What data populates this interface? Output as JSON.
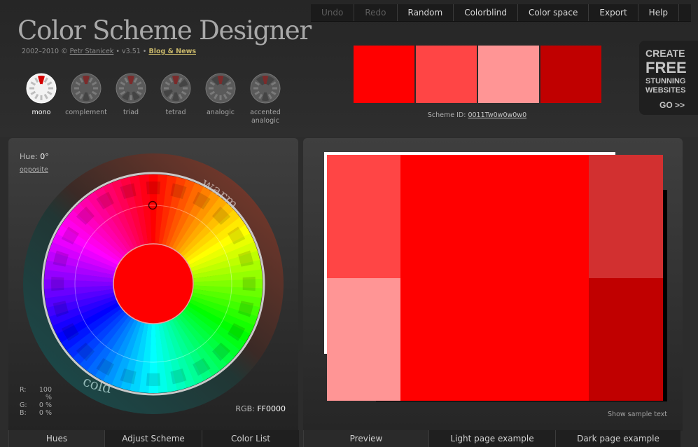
{
  "header": {
    "logo": "Color Scheme Designer",
    "credits": {
      "years": "2002–2010 ©",
      "author": "Petr Stanicek",
      "sep1": "• v3.51 •",
      "blog": "Blog & News"
    }
  },
  "menu": [
    {
      "label": "Undo",
      "enabled": false
    },
    {
      "label": "Redo",
      "enabled": false
    },
    {
      "label": "Random",
      "enabled": true
    },
    {
      "label": "Colorblind",
      "enabled": true
    },
    {
      "label": "Color space",
      "enabled": true
    },
    {
      "label": "Export",
      "enabled": true
    },
    {
      "label": "Help",
      "enabled": true
    }
  ],
  "modes": [
    {
      "label": "mono",
      "active": true,
      "icon": "mono-icon"
    },
    {
      "label": "complement",
      "active": false,
      "icon": "complement-icon"
    },
    {
      "label": "triad",
      "active": false,
      "icon": "triad-icon"
    },
    {
      "label": "tetrad",
      "active": false,
      "icon": "tetrad-icon"
    },
    {
      "label": "analogic",
      "active": false,
      "icon": "analogic-icon"
    },
    {
      "label": "accented analogic",
      "active": false,
      "icon": "accented-analogic-icon"
    }
  ],
  "swatches": [
    "#FF0000",
    "#FF4545",
    "#FF9595",
    "#C00000"
  ],
  "scheme": {
    "label": "Scheme ID:",
    "id": "0011Tw0w0w0w0"
  },
  "ad": {
    "line1": "CREATE",
    "line2": "FREE",
    "line3": "STUNNING",
    "line4": "WEBSITES",
    "line5": "GO >>"
  },
  "wheel": {
    "hue_label": "Hue:",
    "hue_value": "0°",
    "opposite": "opposite",
    "warm": "warm",
    "cold": "cold",
    "center_color": "#FF0000",
    "rgb": [
      {
        "k": "R:",
        "v": "100 %"
      },
      {
        "k": "G:",
        "v": "0 %"
      },
      {
        "k": "B:",
        "v": "0 %"
      }
    ],
    "rgb_label": "RGB:",
    "rgb_hex": "FF0000"
  },
  "preview": {
    "colors": {
      "primary": "#FF0000",
      "light1": "#FF4545",
      "light2": "#FF9595",
      "dark1": "#D23030",
      "dark2": "#C00000",
      "frame": "#FFFFFF",
      "shadow": "#000000"
    },
    "show_sample": "Show sample text"
  },
  "tabs_left": [
    {
      "label": "Hues",
      "active": true
    },
    {
      "label": "Adjust Scheme",
      "active": false
    },
    {
      "label": "Color List",
      "active": false
    }
  ],
  "tabs_right": [
    {
      "label": "Preview",
      "active": true
    },
    {
      "label": "Light page example",
      "active": false
    },
    {
      "label": "Dark page example",
      "active": false
    }
  ]
}
